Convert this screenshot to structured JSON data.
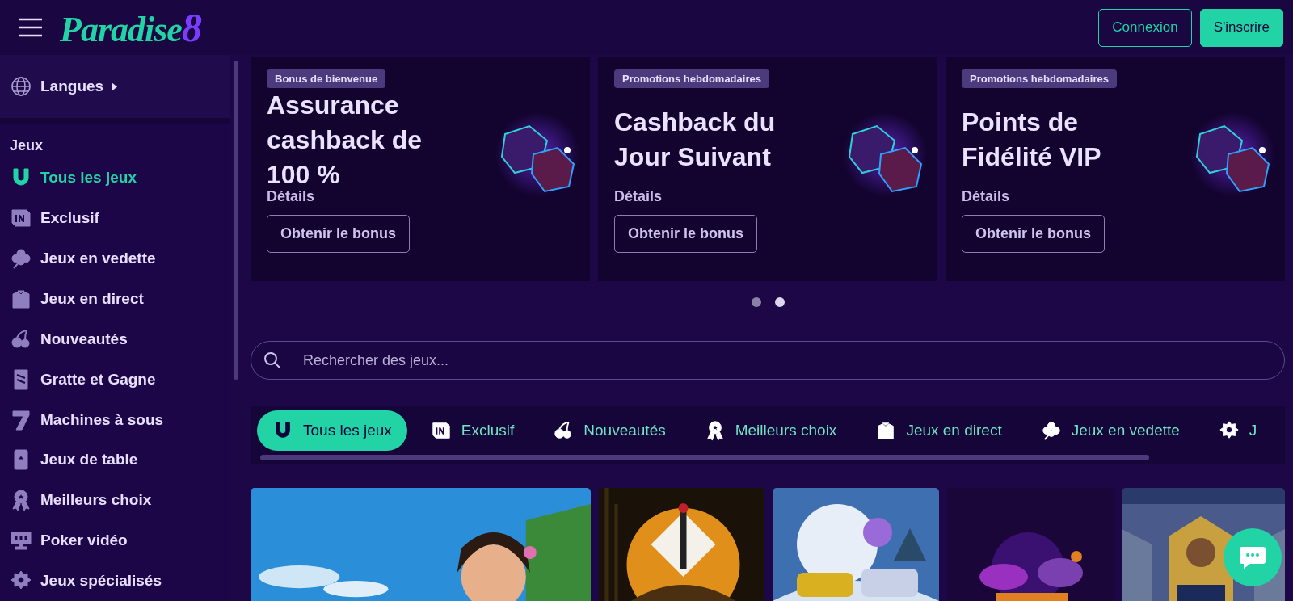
{
  "header": {
    "logo_word": "Paradise",
    "logo_digit": "8",
    "buttons": [
      {
        "label": "Connexion",
        "kind": "outline"
      },
      {
        "label": "S'inscrire",
        "kind": "filled"
      }
    ]
  },
  "sidebar": {
    "language": "Langues",
    "section": "Jeux",
    "items": [
      {
        "label": "Tous les jeux",
        "selected": true
      },
      {
        "label": "Exclusif",
        "selected": false
      },
      {
        "label": "Jeux en vedette",
        "selected": false
      },
      {
        "label": "Jeux en direct",
        "selected": false
      },
      {
        "label": "Nouveautés",
        "selected": false
      },
      {
        "label": "Gratte et Gagne",
        "selected": false
      },
      {
        "label": "Machines à sous",
        "selected": false
      },
      {
        "label": "Jeux de table",
        "selected": false
      },
      {
        "label": "Meilleurs choix",
        "selected": false
      },
      {
        "label": "Poker vidéo",
        "selected": false
      },
      {
        "label": "Jeux spécialisés",
        "selected": false
      }
    ]
  },
  "promos": [
    {
      "tag": "Bonus de bienvenue",
      "title": "Assurance cashback de 100 %",
      "link": "Détails",
      "button": "Obtenir le bonus"
    },
    {
      "tag": "Promotions hebdomadaires",
      "title": "Cashback du Jour Suivant",
      "link": "Détails",
      "button": "Obtenir le bonus"
    },
    {
      "tag": "Promotions hebdomadaires",
      "title": "Points de Fidélité VIP",
      "link": "Détails",
      "button": "Obtenir le bonus"
    }
  ],
  "carousel_dots": [
    {
      "selected": false
    },
    {
      "selected": true
    }
  ],
  "search": {
    "placeholder": "Rechercher des jeux..."
  },
  "category_tabs": [
    {
      "label": "Tous les jeux",
      "selected": true
    },
    {
      "label": "Exclusif",
      "selected": false
    },
    {
      "label": "Nouveautés",
      "selected": false
    },
    {
      "label": "Meilleurs choix",
      "selected": false
    },
    {
      "label": "Jeux en direct",
      "selected": false
    },
    {
      "label": "Jeux en vedette",
      "selected": false
    },
    {
      "label": "J",
      "selected": false
    }
  ]
}
